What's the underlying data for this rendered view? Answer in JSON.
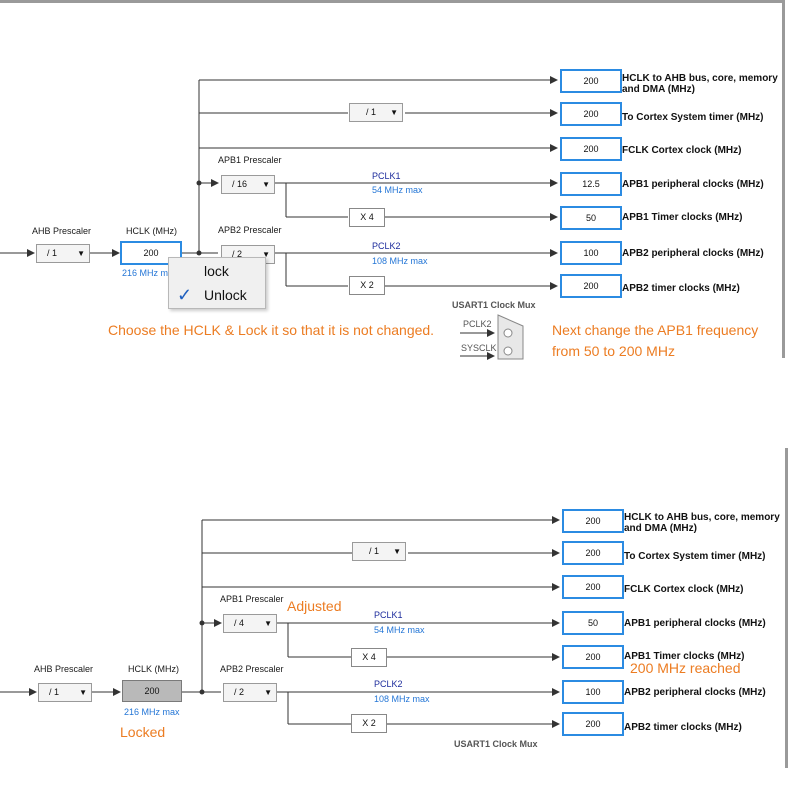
{
  "panels": [
    {
      "ahb_prescaler": {
        "label": "AHB Prescaler",
        "value": "/ 1"
      },
      "hclk": {
        "label": "HCLK (MHz)",
        "value": "200",
        "max": "216 MHz max"
      },
      "apb1_prescaler": {
        "label": "APB1 Prescaler",
        "value": "/ 16"
      },
      "apb2_prescaler": {
        "label": "APB2 Prescaler",
        "value": "/ 2"
      },
      "cortex_divider": "/ 1",
      "pclk1": {
        "label": "PCLK1",
        "max": "54 MHz max"
      },
      "pclk2": {
        "label": "PCLK2",
        "max": "108 MHz max"
      },
      "mult1": "X 4",
      "mult2": "X 2",
      "outputs": [
        {
          "value": "200",
          "label": "HCLK to AHB bus, core, memory and DMA (MHz)"
        },
        {
          "value": "200",
          "label": "To Cortex System timer (MHz)"
        },
        {
          "value": "200",
          "label": "FCLK Cortex clock (MHz)"
        },
        {
          "value": "12.5",
          "label": "APB1 peripheral clocks (MHz)"
        },
        {
          "value": "50",
          "label": "APB1 Timer clocks (MHz)"
        },
        {
          "value": "100",
          "label": "APB2 peripheral clocks (MHz)"
        },
        {
          "value": "200",
          "label": "APB2 timer clocks (MHz)"
        }
      ],
      "usart_mux": {
        "title": "USART1 Clock Mux",
        "in1": "PCLK2",
        "in2": "SYSCLK"
      },
      "context_menu": {
        "items": [
          "lock",
          "Unlock"
        ],
        "checked_index": 1
      },
      "notes": {
        "left": "Choose the HCLK & Lock it so that it is not changed.",
        "right_line1": "Next change the APB1 frequency",
        "right_line2": "from 50 to 200 MHz"
      }
    },
    {
      "ahb_prescaler": {
        "label": "AHB Prescaler",
        "value": "/ 1"
      },
      "hclk": {
        "label": "HCLK (MHz)",
        "value": "200",
        "max": "216 MHz max"
      },
      "apb1_prescaler": {
        "label": "APB1 Prescaler",
        "value": "/ 4"
      },
      "apb2_prescaler": {
        "label": "APB2 Prescaler",
        "value": "/ 2"
      },
      "cortex_divider": "/ 1",
      "pclk1": {
        "label": "PCLK1",
        "max": "54 MHz max"
      },
      "pclk2": {
        "label": "PCLK2",
        "max": "108 MHz max"
      },
      "mult1": "X 4",
      "mult2": "X 2",
      "outputs": [
        {
          "value": "200",
          "label": "HCLK to AHB bus, core, memory and DMA (MHz)"
        },
        {
          "value": "200",
          "label": "To Cortex System timer (MHz)"
        },
        {
          "value": "200",
          "label": "FCLK Cortex clock (MHz)"
        },
        {
          "value": "50",
          "label": "APB1 peripheral clocks (MHz)"
        },
        {
          "value": "200",
          "label": "APB1 Timer clocks (MHz)"
        },
        {
          "value": "100",
          "label": "APB2 peripheral clocks (MHz)"
        },
        {
          "value": "200",
          "label": "APB2 timer clocks (MHz)"
        }
      ],
      "usart_mux": {
        "title": "USART1 Clock Mux"
      },
      "notes": {
        "adjusted": "Adjusted",
        "reached": "200 MHz reached",
        "locked": "Locked"
      }
    }
  ],
  "colors": {
    "accent": "#2b8be2",
    "note": "#ec7c22",
    "locked_fill": "#b9b9b9"
  }
}
